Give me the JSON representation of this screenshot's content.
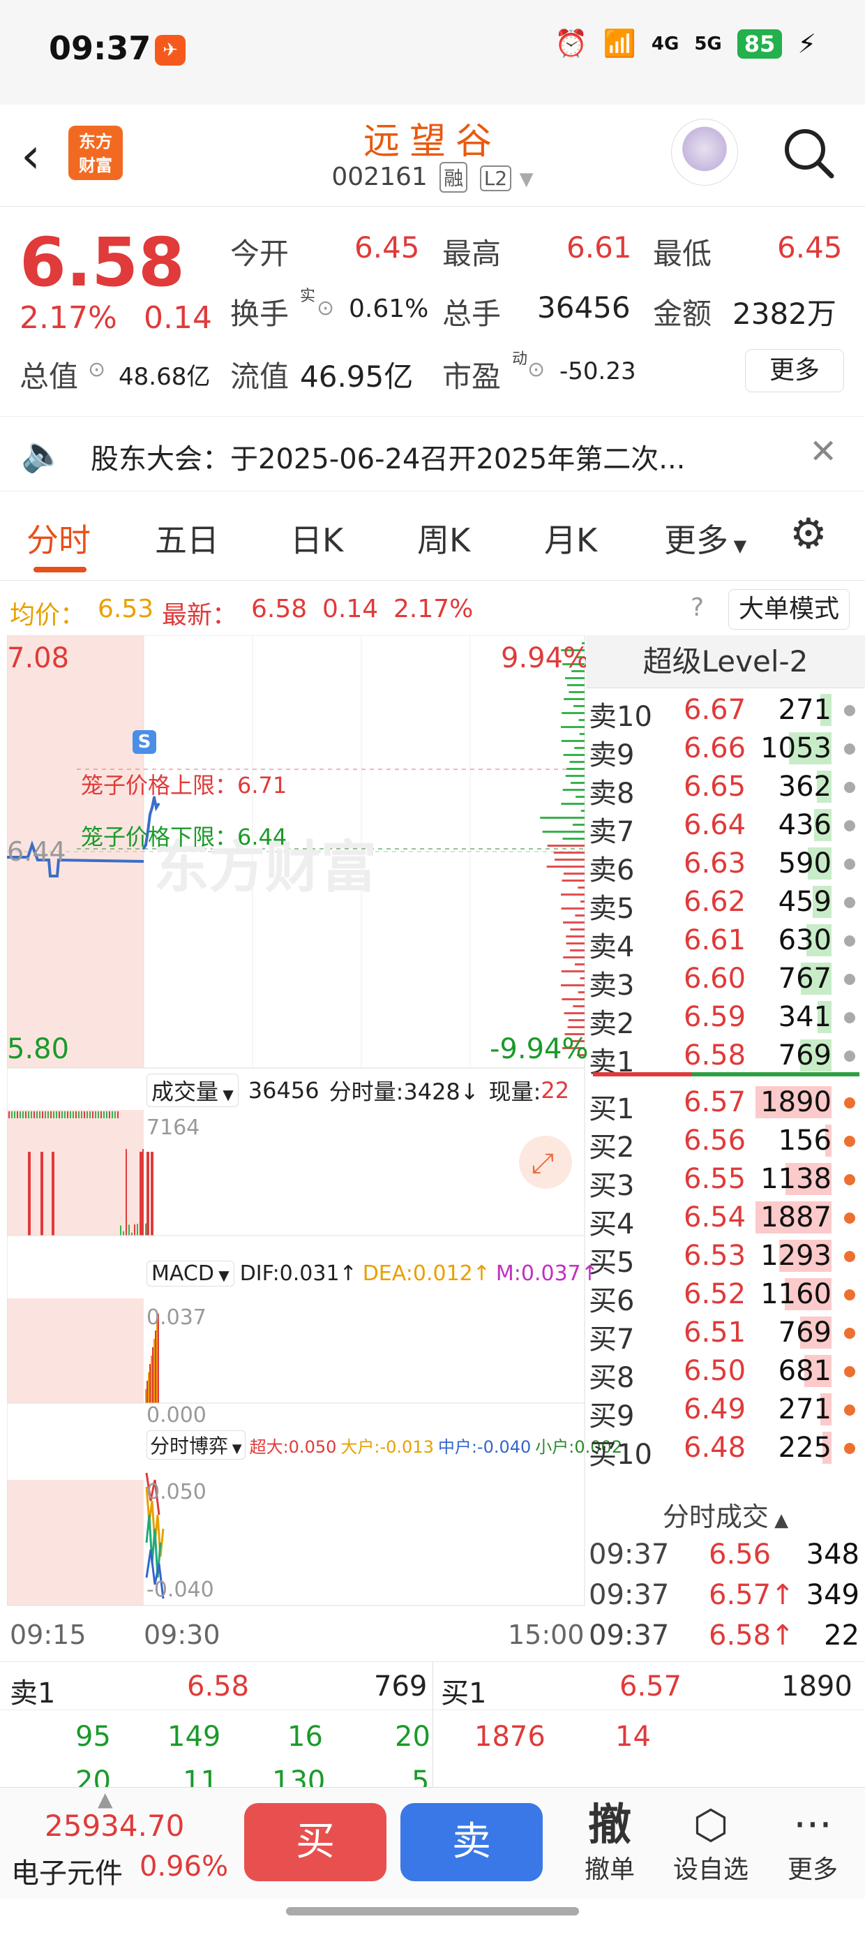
{
  "status": {
    "time": "09:37",
    "battery": "85",
    "net1": "4G",
    "net2": "5G"
  },
  "header": {
    "logo_line1": "东方",
    "logo_line2": "财富",
    "title": "远望谷",
    "code": "002161",
    "tag1": "融",
    "tag2": "L2"
  },
  "quote": {
    "price": "6.58",
    "pct": "2.17%",
    "chg": "0.14",
    "open_label": "今开",
    "open": "6.45",
    "high_label": "最高",
    "high": "6.61",
    "low_label": "最低",
    "low": "6.45",
    "turnover_label": "换手",
    "turnover_sup": "实",
    "turnover": "0.61%",
    "volume_label": "总手",
    "volume": "36456",
    "amount_label": "金额",
    "amount": "2382万",
    "mcap_label": "总值",
    "mcap": "48.68亿",
    "float_label": "流值",
    "float": "46.95亿",
    "pe_label": "市盈",
    "pe_sup": "动",
    "pe": "-50.23",
    "more_label": "更多"
  },
  "notice": {
    "text": "股东大会：于2025-06-24召开2025年第二次..."
  },
  "tabs": [
    "分时",
    "五日",
    "日K",
    "周K",
    "月K",
    "更多"
  ],
  "infoline": {
    "avg_label": "均价：",
    "avg": "6.53",
    "last_label": "最新：",
    "last": "6.58",
    "chg": "0.14",
    "pct": "2.17%",
    "mode_btn": "大单模式"
  },
  "chart": {
    "y_max": "7.08",
    "y_pct_max": "9.94%",
    "y_min": "5.80",
    "y_pct_min": "-9.94%",
    "y_mid": "6.44",
    "cage_upper": "笼子价格上限：6.71",
    "cage_lower": "笼子价格下限：6.44",
    "s_marker": "S",
    "watermark": "东方财富",
    "vol_label": "成交量",
    "vol_total": "36456",
    "vol_per": "分时量:3428↓",
    "vol_now_label": "现量:",
    "vol_now": "22",
    "vol_scale": "7164",
    "macd_label": "MACD",
    "dif": "DIF:0.031↑",
    "dea": "DEA:0.012↑",
    "m": "M:0.037↑",
    "macd_top": "0.037",
    "macd_bot": "0.000",
    "bo_label": "分时博弈",
    "bo_cd": "超大:0.050",
    "bo_dh": "大户:-0.013",
    "bo_zh": "中户:-0.040",
    "bo_xh": "小户:0.002",
    "bo_top": "0.050",
    "bo_bot": "-0.040",
    "t_start": "09:15",
    "t_open": "09:30",
    "t_end": "15:00"
  },
  "chart_data": {
    "type": "line",
    "title": "",
    "x": [
      "09:30",
      "09:31",
      "09:32",
      "09:33",
      "09:34",
      "09:35",
      "09:36",
      "09:37"
    ],
    "values": [
      6.45,
      6.46,
      6.5,
      6.55,
      6.57,
      6.6,
      6.57,
      6.58
    ],
    "prev_close": 6.44,
    "ylim": [
      5.8,
      7.08
    ]
  },
  "book": {
    "title": "超级Level-2",
    "asks": [
      {
        "label": "卖10",
        "price": "6.67",
        "vol": "271"
      },
      {
        "label": "卖9",
        "price": "6.66",
        "vol": "1053"
      },
      {
        "label": "卖8",
        "price": "6.65",
        "vol": "362"
      },
      {
        "label": "卖7",
        "price": "6.64",
        "vol": "436"
      },
      {
        "label": "卖6",
        "price": "6.63",
        "vol": "590"
      },
      {
        "label": "卖5",
        "price": "6.62",
        "vol": "459"
      },
      {
        "label": "卖4",
        "price": "6.61",
        "vol": "630"
      },
      {
        "label": "卖3",
        "price": "6.60",
        "vol": "767"
      },
      {
        "label": "卖2",
        "price": "6.59",
        "vol": "341"
      },
      {
        "label": "卖1",
        "price": "6.58",
        "vol": "769"
      }
    ],
    "bids": [
      {
        "label": "买1",
        "price": "6.57",
        "vol": "1890"
      },
      {
        "label": "买2",
        "price": "6.56",
        "vol": "156"
      },
      {
        "label": "买3",
        "price": "6.55",
        "vol": "1138"
      },
      {
        "label": "买4",
        "price": "6.54",
        "vol": "1887"
      },
      {
        "label": "买5",
        "price": "6.53",
        "vol": "1293"
      },
      {
        "label": "买6",
        "price": "6.52",
        "vol": "1160"
      },
      {
        "label": "买7",
        "price": "6.51",
        "vol": "769"
      },
      {
        "label": "买8",
        "price": "6.50",
        "vol": "681"
      },
      {
        "label": "买9",
        "price": "6.49",
        "vol": "271"
      },
      {
        "label": "买10",
        "price": "6.48",
        "vol": "225"
      }
    ],
    "ticks_title": "分时成交",
    "ticks": [
      {
        "t": "09:37",
        "p": "6.56",
        "v": "348"
      },
      {
        "t": "09:37",
        "p": "6.57↑",
        "v": "349"
      },
      {
        "t": "09:37",
        "p": "6.58↑",
        "v": "22"
      }
    ]
  },
  "lowtbl": {
    "sell1_label": "卖1",
    "sell1_price": "6.58",
    "sell1_vol": "769",
    "buy1_label": "买1",
    "buy1_price": "6.57",
    "buy1_vol": "1890",
    "sell_queue": [
      "95",
      "149",
      "16",
      "20"
    ],
    "sell_queue2": [
      "20",
      "11",
      "130",
      "5"
    ],
    "buy_queue": [
      "1876",
      "14"
    ]
  },
  "bottom": {
    "index": "25934.70",
    "sector": "电子元件",
    "sector_pct": "0.96%",
    "buy": "买",
    "sell": "卖",
    "cancel_icon": "撤",
    "cancel": "撤单",
    "watch": "设自选",
    "more": "更多"
  }
}
